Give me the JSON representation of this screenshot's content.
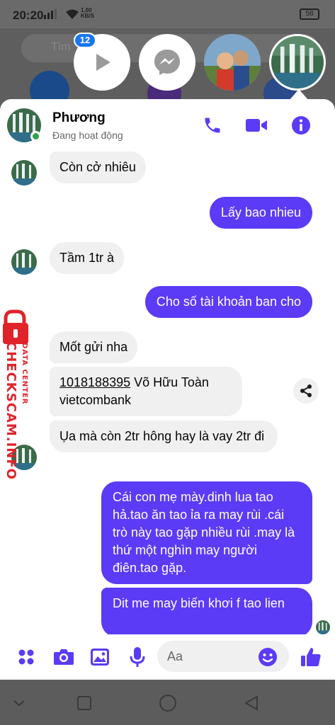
{
  "status_bar": {
    "time": "20:20",
    "net_speed": "1,00\nKB/S",
    "battery": "58"
  },
  "background": {
    "search_placeholder": "Tìm"
  },
  "chat_heads": {
    "badge_count": "12"
  },
  "header": {
    "name": "Phương",
    "status": "Đang hoạt động"
  },
  "messages": {
    "m1": "Còn cở nhiêu",
    "m2": "Lấy bao nhieu",
    "m3": "Tầm 1tr à",
    "m4": "Cho số tài khoản ban cho",
    "m5": "Mốt gửi nha",
    "m6_account": "1018188395",
    "m6_rest": " Võ Hữu Toàn vietcombank",
    "m7": "Ụa mà còn 2tr hông hay là vay 2tr đi",
    "m8": "Cái con mẹ mày.dinh lua tao hả.tao ăn tao ỉa ra may rùi .cái trò này tao gặp nhiều rùi .may là thứ một nghìn may người điên.tao gặp.",
    "m9": "Dit me may biến khơi f tao lien"
  },
  "watermark": {
    "brand": "CHECKSCAM.INFO",
    "subtitle": "DATA CENTER"
  },
  "composer": {
    "placeholder": "Aa"
  },
  "colors": {
    "accent": "#5b3bf5",
    "online": "#31a24c",
    "badge": "#1877f2",
    "watermark": "#e0232b"
  }
}
